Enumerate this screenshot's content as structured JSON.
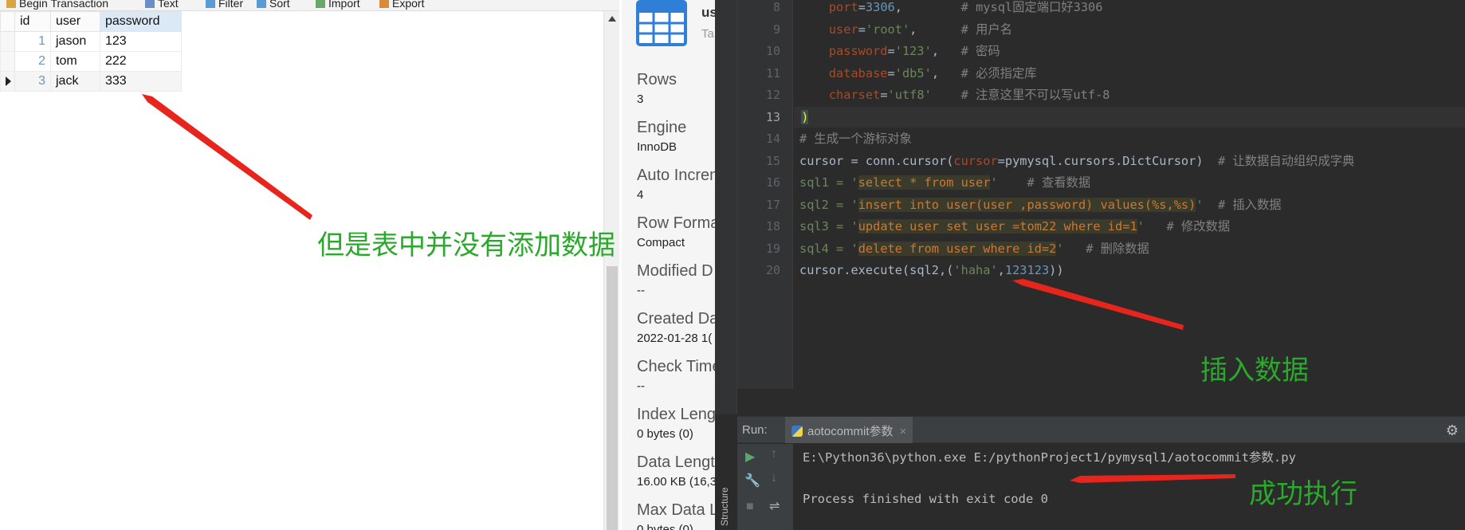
{
  "toolbar": {
    "begin_transaction": "Begin Transaction",
    "text": "Text",
    "filter": "Filter",
    "sort": "Sort",
    "import": "Import",
    "export": "Export"
  },
  "table": {
    "columns": [
      "id",
      "user",
      "password"
    ],
    "rows": [
      {
        "id": "1",
        "user": "jason",
        "password": "123"
      },
      {
        "id": "2",
        "user": "tom",
        "password": "222"
      },
      {
        "id": "3",
        "user": "jack",
        "password": "333"
      }
    ]
  },
  "info": {
    "title": "us",
    "type": "Ta",
    "props": [
      {
        "label": "Rows",
        "value": "3"
      },
      {
        "label": "Engine",
        "value": "InnoDB"
      },
      {
        "label": "Auto Increm",
        "value": "4"
      },
      {
        "label": "Row Format",
        "value": "Compact"
      },
      {
        "label": "Modified D",
        "value": "--"
      },
      {
        "label": "Created Dat",
        "value": "2022-01-28 1("
      },
      {
        "label": "Check Time",
        "value": "--"
      },
      {
        "label": "Index Lengt",
        "value": "0 bytes (0)"
      },
      {
        "label": "Data Length",
        "value": "16.00 KB (16,3"
      },
      {
        "label": "Max Data L",
        "value": "0 bytes (0)"
      }
    ]
  },
  "editor": {
    "line_numbers": [
      "8",
      "9",
      "10",
      "11",
      "12",
      "13",
      "14",
      "15",
      "16",
      "17",
      "18",
      "19",
      "20"
    ],
    "active_line": "13",
    "code": {
      "l8": {
        "kw": "port",
        "eq": "=",
        "val": "3306",
        "sep": ",",
        "comment": "# mysql固定端口好3306"
      },
      "l9": {
        "kw": "user",
        "eq": "=",
        "val": "'root'",
        "sep": ",",
        "comment": "# 用户名"
      },
      "l10": {
        "kw": "password",
        "eq": "=",
        "val": "'123'",
        "sep": ",",
        "comment": "# 密码"
      },
      "l11": {
        "kw": "database",
        "eq": "=",
        "val": "'db5'",
        "sep": ",",
        "comment": "# 必须指定库"
      },
      "l12": {
        "kw": "charset",
        "eq": "=",
        "val": "'utf8'",
        "comment": "# 注意这里不可以写utf-8"
      },
      "l13": {
        "paren": ")"
      },
      "l14": {
        "comment": "# 生成一个游标对象"
      },
      "l15": {
        "a": "cursor = conn.cursor(",
        "kw": "cursor",
        "b": "=pymysql.cursors.DictCursor)",
        "comment": "# 让数据自动组织成字典"
      },
      "l16": {
        "a": "sql1 = '",
        "s1": "select * from user",
        "q": "'",
        "comment": "# 查看数据"
      },
      "l17": {
        "a": "sql2 = '",
        "s1": "insert into user(user ,password) values(%s,%s)",
        "q": "'",
        "comment": "# 插入数据"
      },
      "l18": {
        "a": "sql3 = '",
        "s1": "update user set user =tom22 where id=1",
        "q": "'",
        "comment": "# 修改数据"
      },
      "l19": {
        "a": "sql4 = '",
        "s1": "delete from user where id=2",
        "q": "'",
        "comment": "# 删除数据"
      },
      "l20": {
        "a": "cursor.execute(sql2,(",
        "s": "'haha'",
        "c": ",",
        "n": "123123",
        "b": "))"
      }
    }
  },
  "run": {
    "label": "Run:",
    "tab": "aotocommit参数",
    "tab_close": "×",
    "console": [
      "E:\\Python36\\python.exe E:/pythonProject1/pymysql1/aotocommit参数.py",
      "",
      "Process finished with exit code 0"
    ],
    "structure": "Structure"
  },
  "annotations": {
    "no_data": "但是表中并没有添加数据",
    "insert": "插入数据",
    "success": "成功执行"
  },
  "colors": {
    "annotation_green": "#2aaa2a",
    "arrow_red": "#e8251c"
  }
}
